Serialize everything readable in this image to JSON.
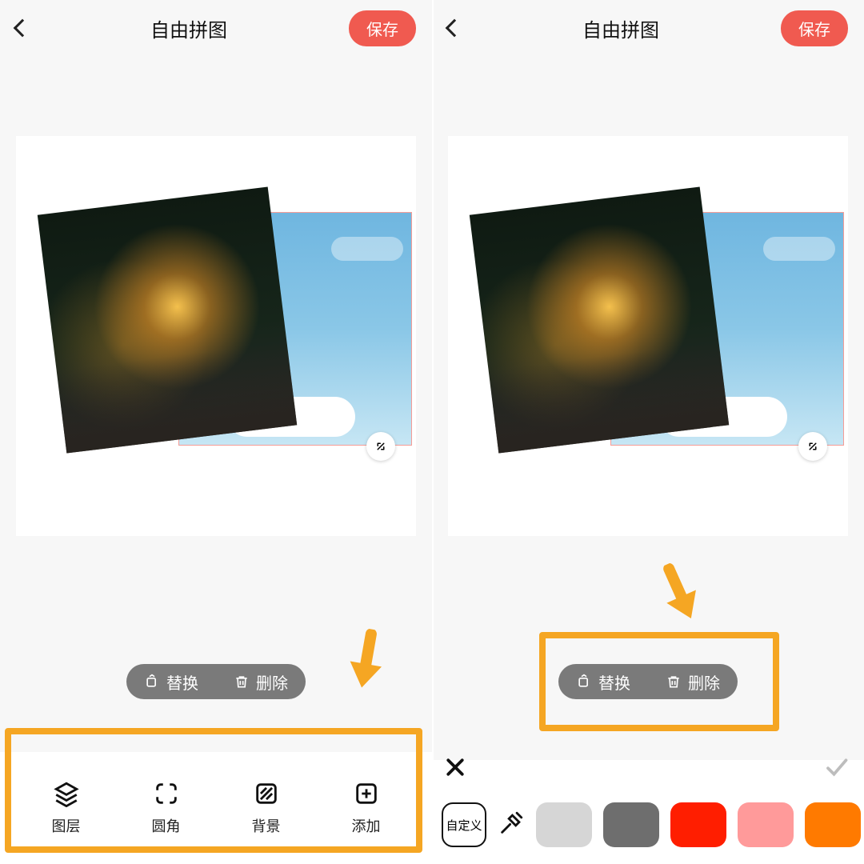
{
  "header": {
    "title": "自由拼图",
    "save_label": "保存"
  },
  "context_actions": {
    "replace": "替换",
    "delete": "删除"
  },
  "tools": {
    "layer": "图层",
    "corner": "圆角",
    "background": "背景",
    "add": "添加"
  },
  "color_panel": {
    "custom_label": "自定义",
    "swatches": [
      "#d6d6d6",
      "#6e6e6e",
      "#ff1e00",
      "#ff9a9a",
      "#ff7a00",
      "#ffb06b"
    ]
  }
}
